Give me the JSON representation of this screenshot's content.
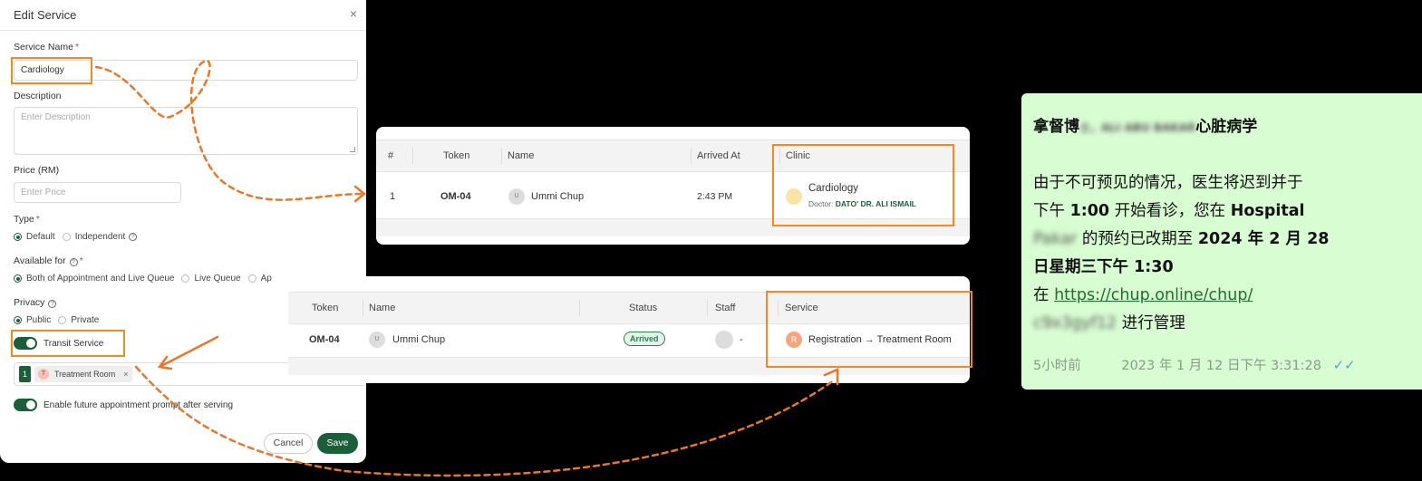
{
  "modal": {
    "title": "Edit Service",
    "close_label": "×",
    "service_name_label": "Service Name",
    "service_name_value": "Cardiology",
    "required_mark": "*",
    "description_label": "Description",
    "description_placeholder": "Enter Description",
    "price_label": "Price (RM)",
    "price_placeholder": "Enter Price",
    "type_label": "Type",
    "type_options": [
      "Default",
      "Independent"
    ],
    "available_label": "Available for",
    "available_options": [
      "Both of Appointment and Live Queue",
      "Live Queue",
      "Ap"
    ],
    "privacy_label": "Privacy",
    "privacy_options": [
      "Public",
      "Private"
    ],
    "transit_label": "Transit Service",
    "transit_chip_index": "1",
    "transit_chip_avatar": "T",
    "transit_chip_label": "Treatment Room",
    "chip_remove": "×",
    "future_prompt_label": "Enable future appointment prompt after serving",
    "cancel_label": "Cancel",
    "save_label": "Save",
    "help_icon": "?"
  },
  "queue_table": {
    "headers": [
      "#",
      "Token",
      "Name",
      "Arrived At",
      "Clinic"
    ],
    "row": {
      "index": "1",
      "token": "OM-04",
      "avatar": "U",
      "name": "Ummi Chup",
      "arrived": "2:43 PM",
      "clinic": "Cardiology",
      "doctor_prefix": "Doctor:",
      "doctor": "DATO' DR. ALI ISMAIL"
    }
  },
  "service_table": {
    "headers": [
      "Token",
      "Name",
      "Status",
      "Staff",
      "Service"
    ],
    "row": {
      "token": "OM-04",
      "avatar": "U",
      "name": "Ummi Chup",
      "status": "Arrived",
      "staff": "-",
      "service_avatar": "R",
      "service": "Registration → Treatment Room"
    }
  },
  "message": {
    "title_prefix": "拿督博",
    "title_blurred": "士，ALI ABU BAKAR",
    "title_suffix": "心脏病学",
    "line1": "由于不可预见的情况，医生将迟到并于",
    "line2_a": "下午 ",
    "line2_b": "1:00",
    "line2_c": " 开始看诊，您在 ",
    "line2_d": "Hospital",
    "line3_blurred": "Pakar",
    "line3_a": " 的预约已改期至 ",
    "line3_b": "2024 年 2 月 28",
    "line4": "日星期三下午 1:30",
    "line5_a": "在 ",
    "link": "https://chup.online/chup/",
    "line6_blurred": "c9x3gyf12",
    "line6_a": " 进行管理",
    "time_ago": "5小时前",
    "timestamp": "2023 年 1 月 12 日下午 3:31:28",
    "ticks": "✓✓"
  },
  "colors": {
    "accent_green": "#1b5e3a",
    "highlight_orange": "#f08a24",
    "message_bg": "#d9fdd3"
  }
}
